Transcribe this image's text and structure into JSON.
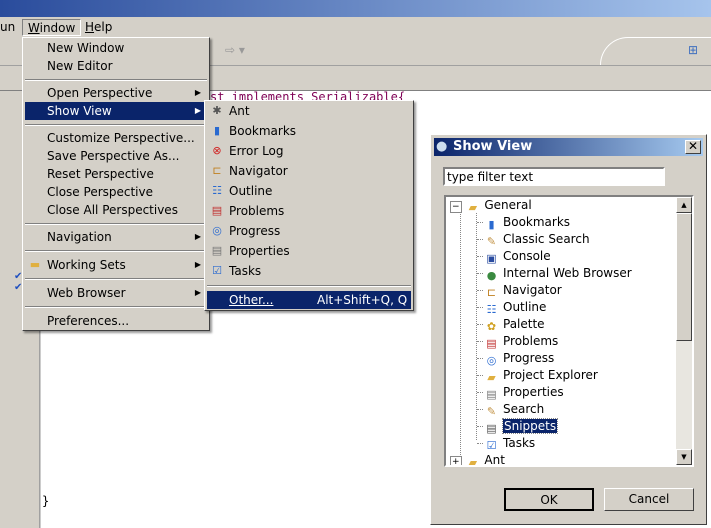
{
  "menubar": {
    "items": [
      "un",
      "Window",
      "Help"
    ]
  },
  "editor": {
    "code_fragment": "st implements Serializable{",
    "closing_brace": "}"
  },
  "window_menu": {
    "items": [
      {
        "label": "New Window"
      },
      {
        "label": "New Editor"
      },
      {
        "label": "Open Perspective",
        "submenu": true
      },
      {
        "label": "Show View",
        "submenu": true,
        "highlighted": true
      },
      {
        "label": "Customize Perspective..."
      },
      {
        "label": "Save Perspective As..."
      },
      {
        "label": "Reset Perspective"
      },
      {
        "label": "Close Perspective"
      },
      {
        "label": "Close All Perspectives"
      },
      {
        "label": "Navigation",
        "submenu": true
      },
      {
        "label": "Working Sets",
        "submenu": true
      },
      {
        "label": "Web Browser",
        "submenu": true
      },
      {
        "label": "Preferences..."
      }
    ]
  },
  "show_view_menu": {
    "items": [
      {
        "label": "Ant",
        "icon": "ant-icon"
      },
      {
        "label": "Bookmarks",
        "icon": "bookmarks-icon"
      },
      {
        "label": "Error Log",
        "icon": "error-log-icon"
      },
      {
        "label": "Navigator",
        "icon": "navigator-icon"
      },
      {
        "label": "Outline",
        "icon": "outline-icon"
      },
      {
        "label": "Problems",
        "icon": "problems-icon"
      },
      {
        "label": "Progress",
        "icon": "progress-icon"
      },
      {
        "label": "Properties",
        "icon": "properties-icon"
      },
      {
        "label": "Tasks",
        "icon": "tasks-icon"
      }
    ],
    "other": {
      "label": "Other...",
      "shortcut": "Alt+Shift+Q, Q"
    }
  },
  "dialog": {
    "title": "Show View",
    "filter_value": "type filter text",
    "tree": {
      "general": "General",
      "children": [
        "Bookmarks",
        "Classic Search",
        "Console",
        "Internal Web Browser",
        "Navigator",
        "Outline",
        "Palette",
        "Problems",
        "Progress",
        "Project Explorer",
        "Properties",
        "Search",
        "Snippets",
        "Tasks"
      ],
      "selected": "Snippets",
      "ant": "Ant"
    },
    "ok": "OK",
    "cancel": "Cancel"
  },
  "colors": {
    "highlight": "#0a246a",
    "menu_bg": "#d4d0c8"
  }
}
